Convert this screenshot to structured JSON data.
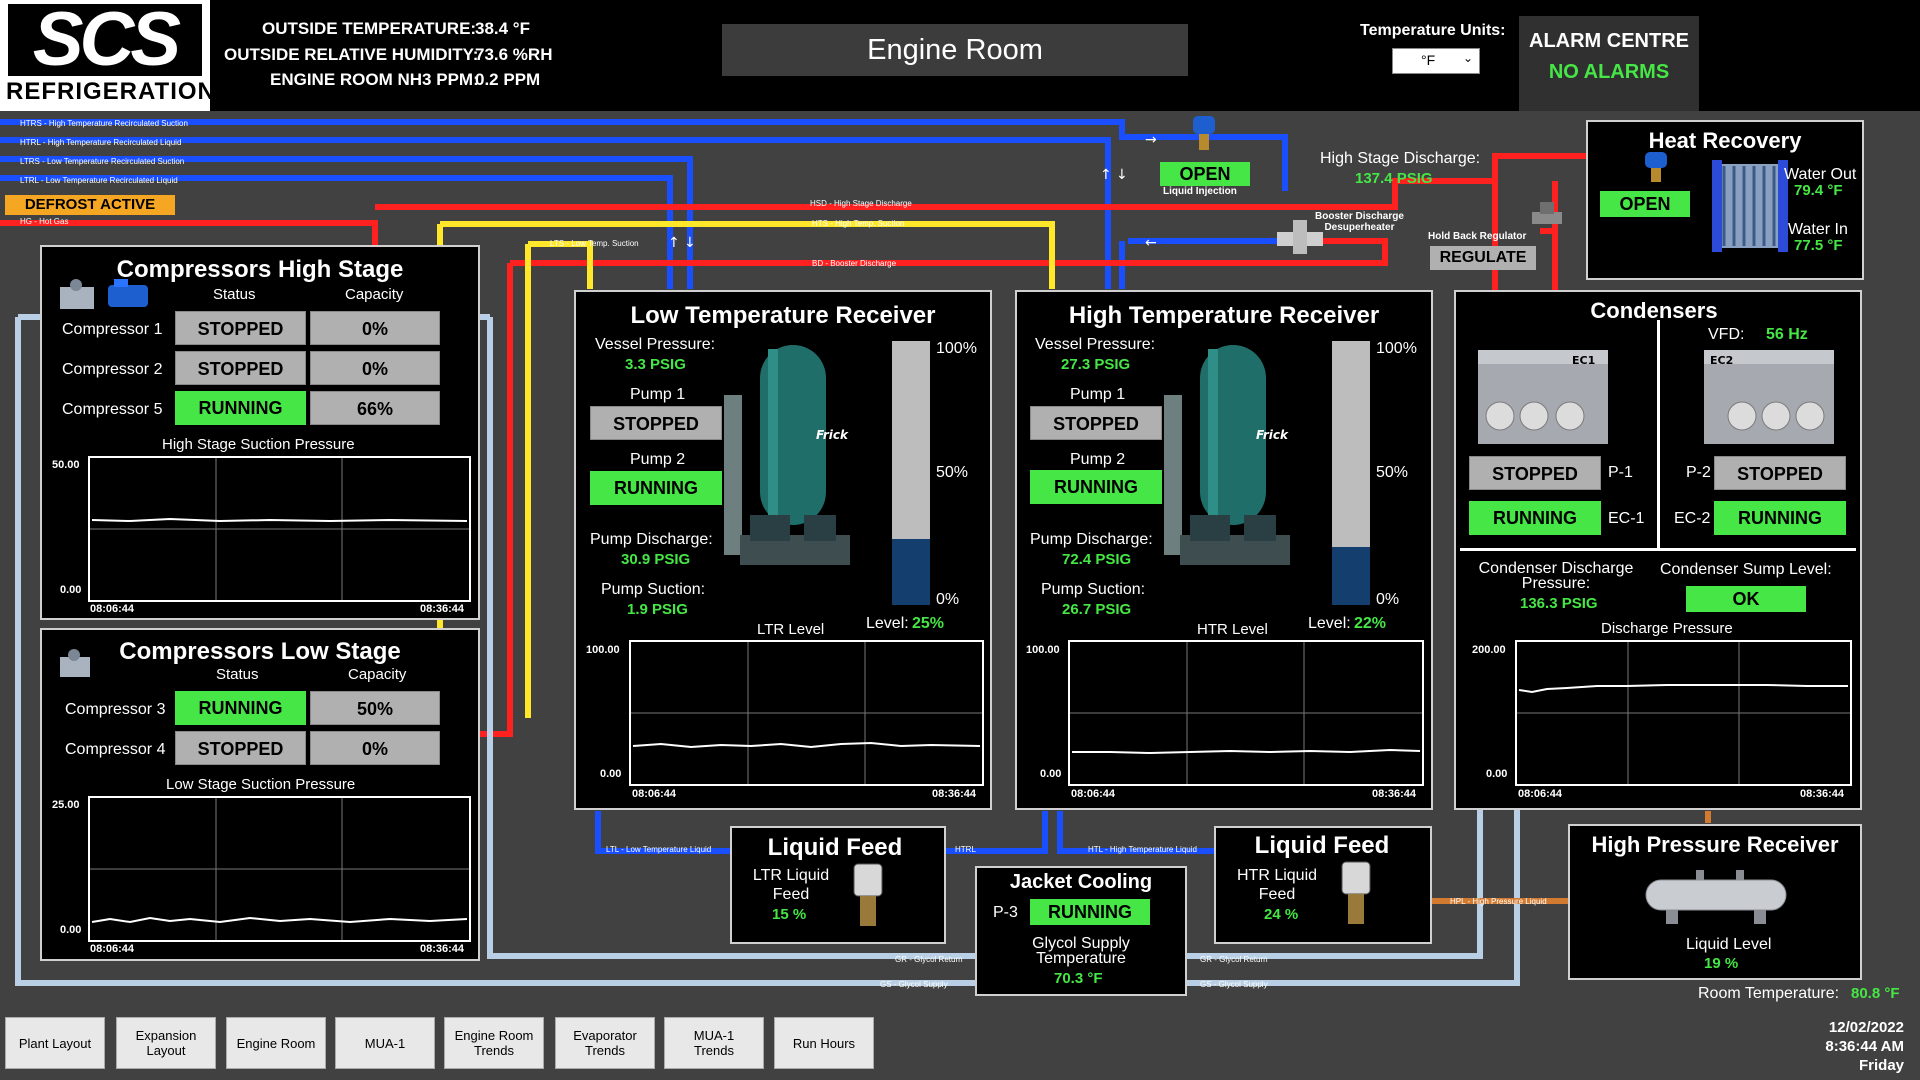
{
  "header": {
    "logo_main": "SCS",
    "logo_sub": "REFRIGERATION",
    "outside_temp_label": "OUTSIDE TEMPERATURE:",
    "outside_temp_value": "38.4 °F",
    "outside_rh_label": "OUTSIDE RELATIVE HUMIDITY:",
    "outside_rh_value": "73.6 %RH",
    "nh3_label": "ENGINE ROOM NH3 PPM:",
    "nh3_value": "0.2 PPM",
    "title": "Engine Room",
    "units_label": "Temperature Units:",
    "units_value": "°F",
    "alarm_title": "ALARM CENTRE",
    "alarm_status": "NO ALARMS"
  },
  "pipes": {
    "htrs": "HTRS - High Temperature Recirculated Suction",
    "htrl": "HTRL - High Temperature Recirculated Liquid",
    "ltrs": "LTRS - Low Temperature Recirculated Suction",
    "ltrl": "LTRL - Low Temperature Recirculated Liquid",
    "hg": "HG - Hot Gas",
    "hsd": "HSD - High Stage Discharge",
    "hts": "HTS - High Temp. Suction",
    "lts": "LTS - Low Temp. Suction",
    "bd": "BD - Booster Discharge",
    "ltl": "LTL - Low Temperature Liquid",
    "htrl_short": "HTRL",
    "htl": "HTL - High Temperature Liquid",
    "hpl": "HPL - High Pressure Liquid",
    "gr1": "GR - Glycol Return",
    "gr2": "GR - Glycol Return",
    "gs1": "GS - Glycol Supply",
    "gs2": "GS - Glycol Supply"
  },
  "defrost": "DEFROST ACTIVE",
  "liquid_injection": {
    "status": "OPEN",
    "label": "Liquid Injection"
  },
  "high_stage_discharge": {
    "label": "High Stage Discharge:",
    "value": "137.4 PSIG"
  },
  "booster_desup": "Booster Discharge\nDesuperheater",
  "hold_back": {
    "label": "Hold Back Regulator",
    "status": "REGULATE"
  },
  "heat_recovery": {
    "title": "Heat Recovery",
    "valve": "OPEN",
    "water_out_label": "Water Out",
    "water_out_value": "79.4 °F",
    "water_in_label": "Water In",
    "water_in_value": "77.5 °F"
  },
  "comp_high": {
    "title": "Compressors High Stage",
    "col_status": "Status",
    "col_capacity": "Capacity",
    "rows": [
      {
        "name": "Compressor 1",
        "status": "STOPPED",
        "capacity": "0%"
      },
      {
        "name": "Compressor 2",
        "status": "STOPPED",
        "capacity": "0%"
      },
      {
        "name": "Compressor 5",
        "status": "RUNNING",
        "capacity": "66%"
      }
    ],
    "trend_title": "High Stage Suction Pressure",
    "ymax": "50.00",
    "ymin": "0.00",
    "t0": "08:06:44",
    "t1": "08:36:44"
  },
  "comp_low": {
    "title": "Compressors Low Stage",
    "col_status": "Status",
    "col_capacity": "Capacity",
    "rows": [
      {
        "name": "Compressor 3",
        "status": "RUNNING",
        "capacity": "50%"
      },
      {
        "name": "Compressor 4",
        "status": "STOPPED",
        "capacity": "0%"
      }
    ],
    "trend_title": "Low Stage Suction Pressure",
    "ymax": "25.00",
    "ymin": "0.00",
    "t0": "08:06:44",
    "t1": "08:36:44"
  },
  "ltr": {
    "title": "Low Temperature Receiver",
    "vessel_label": "Vessel Pressure:",
    "vessel_value": "3.3 PSIG",
    "pump1_label": "Pump 1",
    "pump1_status": "STOPPED",
    "pump2_label": "Pump 2",
    "pump2_status": "RUNNING",
    "discharge_label": "Pump Discharge:",
    "discharge_value": "30.9 PSIG",
    "suction_label": "Pump Suction:",
    "suction_value": "1.9 PSIG",
    "brand": "Frick",
    "level_label": "Level:",
    "level_value": "25%",
    "level_fraction": 0.25,
    "s100": "100%",
    "s50": "50%",
    "s0": "0%",
    "trend_title": "LTR Level",
    "ymax": "100.00",
    "ymin": "0.00",
    "t0": "08:06:44",
    "t1": "08:36:44"
  },
  "htr": {
    "title": "High Temperature Receiver",
    "vessel_label": "Vessel Pressure:",
    "vessel_value": "27.3 PSIG",
    "pump1_label": "Pump 1",
    "pump1_status": "STOPPED",
    "pump2_label": "Pump 2",
    "pump2_status": "RUNNING",
    "discharge_label": "Pump Discharge:",
    "discharge_value": "72.4 PSIG",
    "suction_label": "Pump Suction:",
    "suction_value": "26.7 PSIG",
    "brand": "Frick",
    "level_label": "Level:",
    "level_value": "22%",
    "level_fraction": 0.22,
    "s100": "100%",
    "s50": "50%",
    "s0": "0%",
    "trend_title": "HTR Level",
    "ymax": "100.00",
    "ymin": "0.00",
    "t0": "08:06:44",
    "t1": "08:36:44"
  },
  "condensers": {
    "title": "Condensers",
    "vfd_label": "VFD:",
    "vfd_value": "56 Hz",
    "ec1": "EC1",
    "ec2": "EC2",
    "p1_status": "STOPPED",
    "p1_label": "P-1",
    "p2_label": "P-2",
    "p2_status": "STOPPED",
    "ec1_status": "RUNNING",
    "ec1_label": "EC-1",
    "ec2_label": "EC-2",
    "ec2_status": "RUNNING",
    "discharge_label": "Condenser Discharge\nPressure:",
    "discharge_value": "136.3 PSIG",
    "sump_label": "Condenser Sump Level:",
    "sump_status": "OK",
    "trend_title": "Discharge Pressure",
    "ymax": "200.00",
    "ymin": "0.00",
    "t0": "08:06:44",
    "t1": "08:36:44"
  },
  "liquid_feed_ltr": {
    "title": "Liquid Feed",
    "label": "LTR Liquid\nFeed",
    "value": "15 %"
  },
  "liquid_feed_htr": {
    "title": "Liquid Feed",
    "label": "HTR Liquid\nFeed",
    "value": "24 %"
  },
  "jacket": {
    "title": "Jacket Cooling",
    "pump_label": "P-3",
    "pump_status": "RUNNING",
    "supply_label": "Glycol Supply\nTemperature",
    "supply_value": "70.3 °F"
  },
  "hpr": {
    "title": "High Pressure Receiver",
    "level_label": "Liquid Level",
    "level_value": "19 %"
  },
  "room_temp": {
    "label": "Room Temperature:",
    "value": "80.8 °F"
  },
  "footer": {
    "buttons": [
      "Plant Layout",
      "Expansion\nLayout",
      "Engine Room",
      "MUA-1",
      "Engine Room\nTrends",
      "Evaporator\nTrends",
      "MUA-1\nTrends",
      "Run Hours"
    ],
    "date": "12/02/2022",
    "time": "8:36:44 AM",
    "day": "Friday"
  },
  "colors": {
    "running": "#46e646",
    "stopped": "#b0b0b0",
    "value_green": "#45e645",
    "pipe_blue": "#1a4fff",
    "pipe_red": "#ff2020",
    "pipe_yellow": "#ffe82a",
    "glycol": "#b9cfe6"
  }
}
